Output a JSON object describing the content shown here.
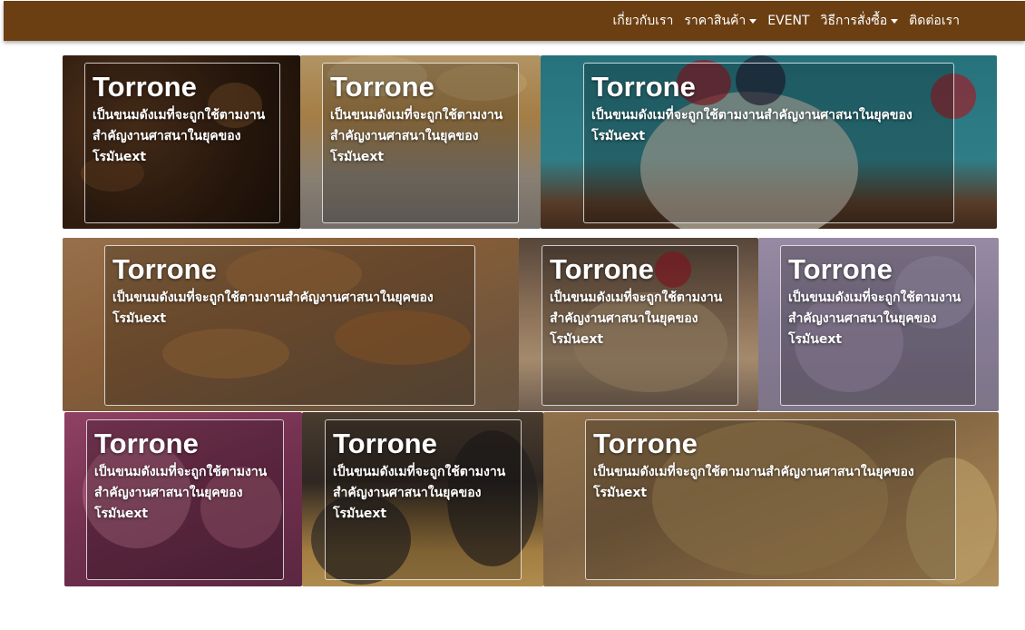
{
  "nav": {
    "items": [
      {
        "label": "เกี่ยวกับเรา",
        "dropdown": false
      },
      {
        "label": "ราคาสินค้า",
        "dropdown": true
      },
      {
        "label": "EVENT",
        "dropdown": false
      },
      {
        "label": "วิธีการสั่งซื้อ",
        "dropdown": true
      },
      {
        "label": "ติดต่อเรา",
        "dropdown": false
      }
    ]
  },
  "colors": {
    "navbar": "#6b3f12",
    "caption_text": "#ffffff"
  },
  "tiles": [
    {
      "title": "Torrone",
      "desc": "เป็นขนมดังเมที่จะถูกใช้ตามงานสำคัญงานศาสนาในยุคของโรมันext",
      "image": "chocolates-photo"
    },
    {
      "title": "Torrone",
      "desc": "เป็นขนมดังเมที่จะถูกใช้ตามงานสำคัญงานศาสนาในยุคของโรมันext",
      "image": "bread-rolls-photo"
    },
    {
      "title": "Torrone",
      "desc": "เป็นขนมดังเมที่จะถูกใช้ตามงานสำคัญงานศาสนาในยุคของโรมันext",
      "image": "berry-yogurt-photo"
    },
    {
      "title": "Torrone",
      "desc": "เป็นขนมดังเมที่จะถูกใช้ตามงานสำคัญงานศาสนาในยุคของโรมันext",
      "image": "cannoli-photo"
    },
    {
      "title": "Torrone",
      "desc": "เป็นขนมดังเมที่จะถูกใช้ตามงานสำคัญงานศาสนาในยุคของโรมันext",
      "image": "tiramisu-photo"
    },
    {
      "title": "Torrone",
      "desc": "เป็นขนมดังเมที่จะถูกใช้ตามงานสำคัญงานศาสนาในยุคของโรมันext",
      "image": "ice-cream-photo"
    },
    {
      "title": "Torrone",
      "desc": "เป็นขนมดังเมที่จะถูกใช้ตามงานสำคัญงานศาสนาในยุคของโรมันext",
      "image": "pink-pastry-photo"
    },
    {
      "title": "Torrone",
      "desc": "เป็นขนมดังเมที่จะถูกใช้ตามงานสำคัญงานศาสนาในยุคของโรมันext",
      "image": "cookie-jars-photo"
    },
    {
      "title": "Torrone",
      "desc": "เป็นขนมดังเมที่จะถูกใช้ตามงานสำคัญงานศาสนาในยุคของโรมันext",
      "image": "colomba-cake-photo"
    }
  ]
}
